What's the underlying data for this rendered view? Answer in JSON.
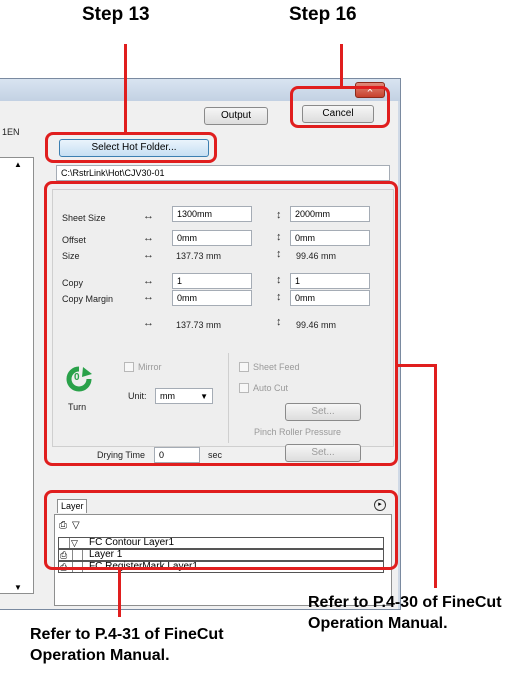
{
  "callouts": {
    "step13": "Step 13",
    "step16": "Step 16",
    "ref_right": "Refer to P.4-30 of FineCut Operation Manual.",
    "ref_left": "Refer to P.4-31 of FineCut Operation Manual."
  },
  "window": {
    "close_glyph": "×",
    "left_fragment": "1EN",
    "output_button": "Output",
    "cancel_button": "Cancel",
    "select_hot_folder_button": "Select Hot Folder...",
    "hot_folder_path": "C:\\RstrLink\\Hot\\CJV30-01"
  },
  "settings": {
    "sheet_size_label": "Sheet Size",
    "sheet_size_w": "1300mm",
    "sheet_size_h": "2000mm",
    "offset_label": "Offset",
    "offset_x": "0mm",
    "offset_y": "0mm",
    "size_label": "Size",
    "size_w": "137.73 mm",
    "size_h": "99.46 mm",
    "copy_label": "Copy",
    "copy_x": "1",
    "copy_y": "1",
    "copy_margin_label": "Copy Margin",
    "copy_margin_x": "0mm",
    "copy_margin_y": "0mm",
    "total_w": "137.73 mm",
    "total_h": "99.46 mm",
    "horizontal_arrow": "↔",
    "vertical_arrow": "↕",
    "turn_value": "0",
    "turn_label": "Turn",
    "mirror_label": "Mirror",
    "unit_label": "Unit:",
    "unit_value": "mm",
    "sheet_feed_label": "Sheet Feed",
    "auto_cut_label": "Auto Cut",
    "set_button_1": "Set...",
    "pinch_roller_label": "Pinch Roller Pressure",
    "drying_time_label": "Drying Time",
    "drying_time_value": "0",
    "drying_time_unit": "sec",
    "set_button_2": "Set..."
  },
  "layer": {
    "tab_label": "Layer",
    "rows": [
      {
        "name": "FC Contour Layer1"
      },
      {
        "name": "Layer 1"
      },
      {
        "name": "FC RegisterMark Layer1"
      }
    ]
  },
  "colors": {
    "callout_red": "#e01e1e",
    "turn_green": "#2aa14a"
  }
}
